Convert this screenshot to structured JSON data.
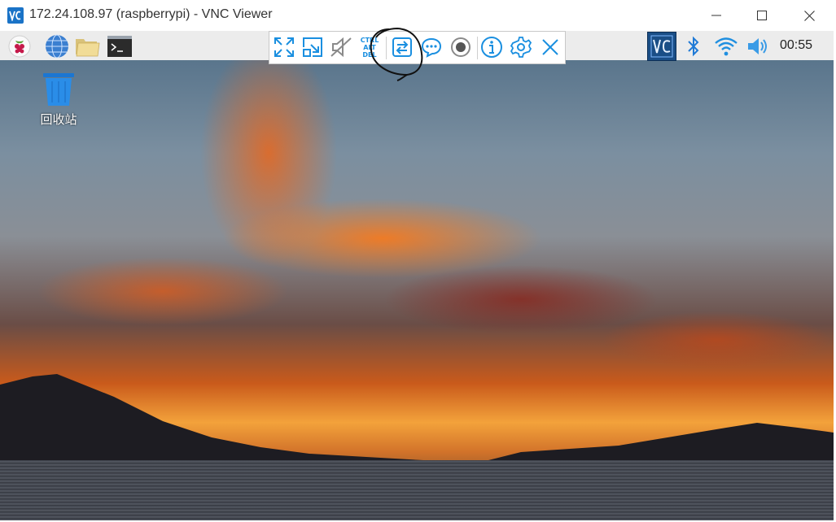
{
  "window": {
    "title": "172.24.108.97 (raspberrypi) - VNC Viewer",
    "icon": "vnc-viewer-icon",
    "controls": [
      "minimize-icon",
      "maximize-icon",
      "close-icon"
    ]
  },
  "taskbar": {
    "left_icons": [
      "raspberry-menu-icon",
      "web-browser-globe-icon",
      "file-manager-folder-icon",
      "terminal-icon"
    ],
    "tray_icons": [
      "vnc-server-icon",
      "bluetooth-icon",
      "wifi-icon",
      "volume-icon"
    ],
    "clock": "00:55"
  },
  "desktop": {
    "icons": [
      {
        "label": "回收站",
        "icon": "trash-icon"
      }
    ]
  },
  "vnc_toolbar": {
    "buttons": [
      "fullscreen-icon",
      "scale-icon",
      "audio-muted-icon",
      "ctrl-alt-del-icon",
      "file-transfer-icon",
      "chat-icon",
      "record-icon",
      "info-icon",
      "settings-icon",
      "close-toolbar-icon"
    ],
    "ctrl_alt_del_text": [
      "CTRL",
      "ALT",
      "DEL"
    ]
  },
  "colors": {
    "accent": "#1a8fe0",
    "taskbar_bg": "#ececec",
    "vnc_tray_bg": "#1a4e86"
  }
}
